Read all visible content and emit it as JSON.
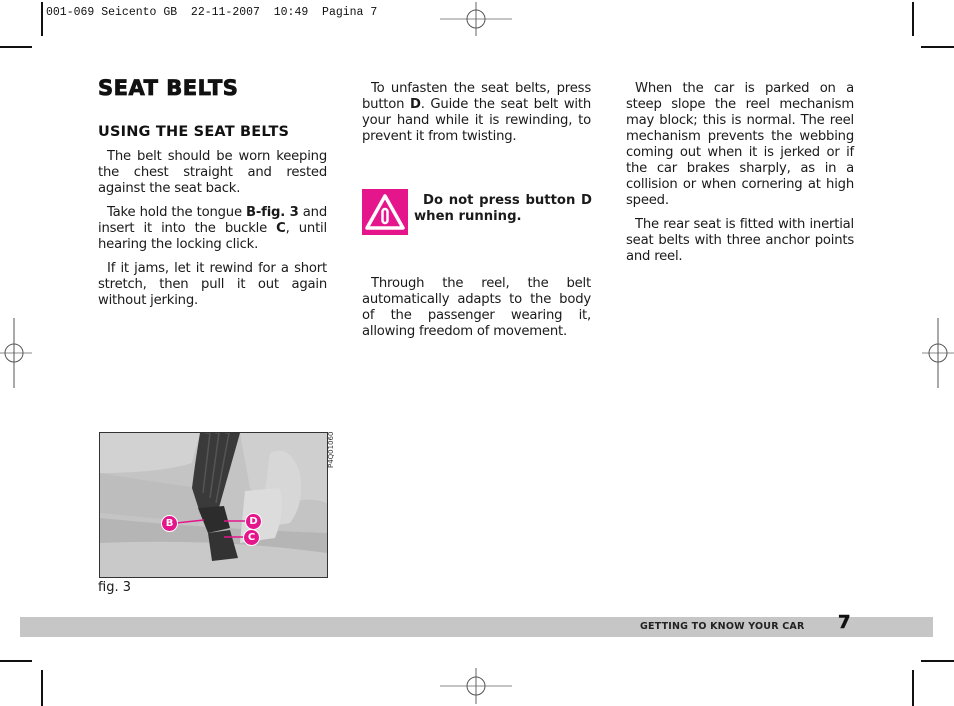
{
  "slug": "001-069 Seicento GB  22-11-2007  10:49  Pagina 7",
  "title": "SEAT BELTS",
  "col1": {
    "subtitle": "USING THE SEAT BELTS",
    "p1": "The belt should be worn keeping the chest straight and rested against the seat back.",
    "p2_a": "Take hold the tongue ",
    "p2_b": "B-fig. 3",
    "p2_c": " and insert it into the buckle ",
    "p2_d": "C",
    "p2_e": ", until hearing the locking click.",
    "p3": "If it jams, let it rewind for a short stretch, then pull it out again without jerking."
  },
  "col2": {
    "p1_a": "To unfasten the seat belts, press button ",
    "p1_b": "D",
    "p1_c": ". Guide the seat belt with your hand while it is rewinding, to prevent it from twisting.",
    "warning": "Do not press button D when running.",
    "p2": "Through the reel, the belt automatically adapts to the body of the passenger wearing it, allowing freedom of movement."
  },
  "col3": {
    "p1": "When the car is parked on a steep slope the reel mechanism may block; this is normal. The reel mechanism prevents the webbing coming out when it is jerked or if the car brakes sharply, as in a collision or when cornering at high speed.",
    "p2": "The rear seat is fitted with inertial seat belts with three anchor points and reel."
  },
  "figure": {
    "code": "P4Q01060",
    "caption": "fig. 3",
    "callouts": {
      "b": "B",
      "c": "C",
      "d": "D"
    },
    "accent": "#e5158c"
  },
  "footer": {
    "section": "GETTING TO KNOW YOUR CAR",
    "page": "7"
  },
  "colors": {
    "warning": "#e5158c",
    "footer_bar": "#c6c6c6"
  }
}
